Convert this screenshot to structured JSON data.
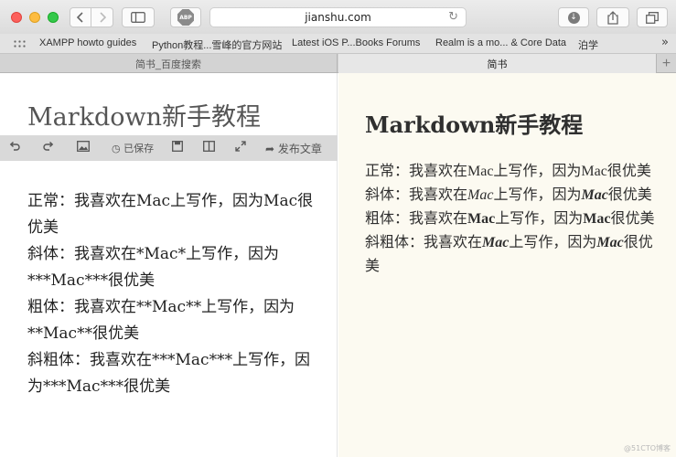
{
  "browser": {
    "address": "jianshu.com",
    "abp_label": "ABP"
  },
  "bookmarks": [
    "XAMPP howto guides",
    "Python教程...雪峰的官方网站",
    "Latest iOS P...Books Forums",
    "Realm is a mo... & Core Data",
    "泊学"
  ],
  "tabs": [
    {
      "label": "简书_百度搜索",
      "active": false
    },
    {
      "label": "简书",
      "active": true
    }
  ],
  "editor": {
    "title": "Markdown新手教程",
    "toolbar": {
      "saved_label": "已保存",
      "publish_label": "发布文章"
    },
    "lines": [
      "正常：我喜欢在Mac上写作，因为Mac很优美",
      "斜体：我喜欢在*Mac*上写作，因为***Mac***很优美",
      "粗体：我喜欢在**Mac**上写作，因为**Mac**很优美",
      "斜粗体：我喜欢在***Mac***上写作，因为***Mac***很优美"
    ]
  },
  "preview": {
    "title": "Markdown新手教程",
    "normal": {
      "prefix": "正常：我喜欢在Mac上写作，因为Mac很优美"
    },
    "italic": {
      "p1": "斜体：我喜欢在",
      "em1": "Mac",
      "p2": "上写作，因为",
      "em2": "Mac",
      "p3": "很优美"
    },
    "bold": {
      "p1": "粗体：我喜欢在",
      "b1": "Mac",
      "p2": "上写作，因为",
      "b2": "Mac",
      "p3": "很优美"
    },
    "bolditalic": {
      "p1": "斜粗体：我喜欢在",
      "bi1": "Mac",
      "p2": "上写作，因为",
      "bi2": "Mac",
      "p3": "很优美"
    }
  },
  "watermark": "@51CTO博客"
}
